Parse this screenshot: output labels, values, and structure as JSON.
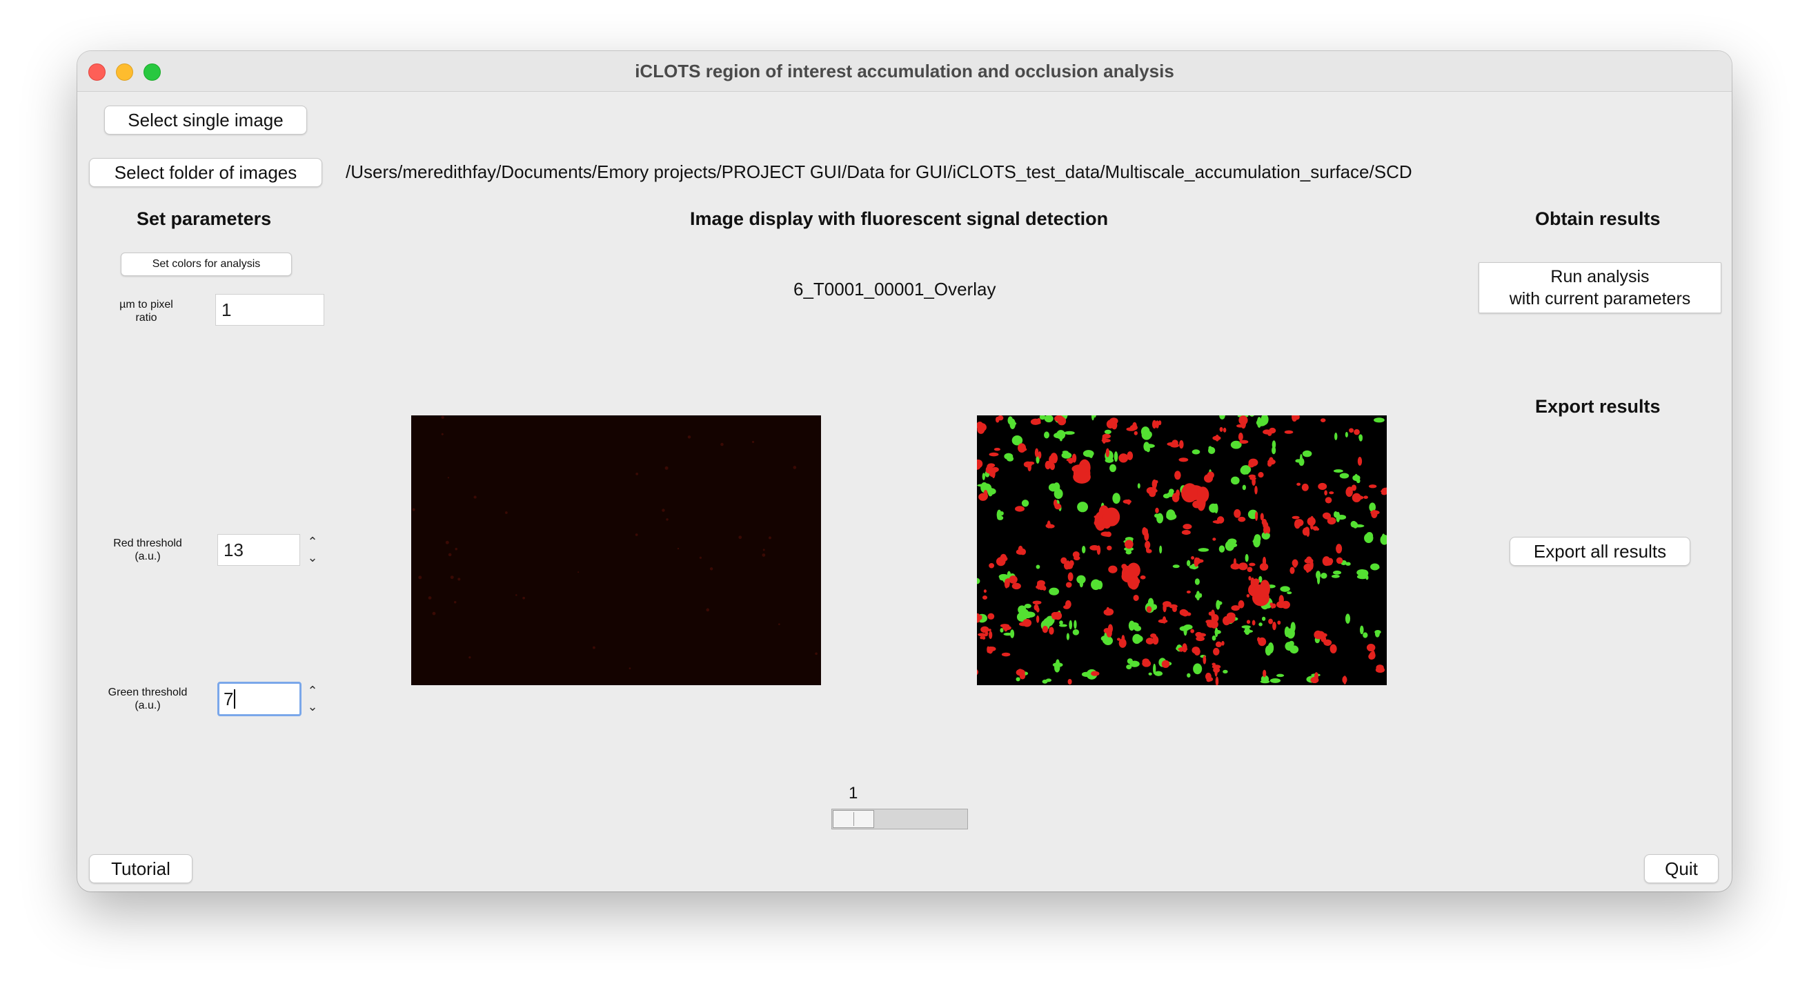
{
  "window": {
    "title": "iCLOTS region of interest accumulation and occlusion analysis"
  },
  "toolbar": {
    "select_single_label": "Select single image",
    "select_folder_label": "Select folder of images",
    "folder_path": "/Users/meredithfay/Documents/Emory projects/PROJECT GUI/Data for GUI/iCLOTS_test_data/Multiscale_accumulation_surface/SCD"
  },
  "parameters": {
    "heading": "Set parameters",
    "set_colors_label": "Set colors for analysis",
    "ratio_label_line1": "µm to pixel",
    "ratio_label_line2": "ratio",
    "ratio_value": "1",
    "red_label_line1": "Red threshold",
    "red_label_line2": "(a.u.)",
    "red_value": "13",
    "green_label_line1": "Green threshold",
    "green_label_line2": "(a.u.)",
    "green_value": "7"
  },
  "display": {
    "heading": "Image display with fluorescent signal detection",
    "image_name": "6_T0001_00001_Overlay",
    "slider_value": "1",
    "slider_level_fraction": 0.0
  },
  "results": {
    "obtain_heading": "Obtain results",
    "run_label_line1": "Run analysis",
    "run_label_line2": "with current parameters",
    "export_heading": "Export results",
    "export_label": "Export all results"
  },
  "footer": {
    "tutorial_label": "Tutorial",
    "quit_label": "Quit"
  },
  "colors": {
    "window_bg": "#ececec",
    "signal_red": "#e4231e",
    "signal_green": "#54e032",
    "focus_ring": "#7aa7ea"
  }
}
